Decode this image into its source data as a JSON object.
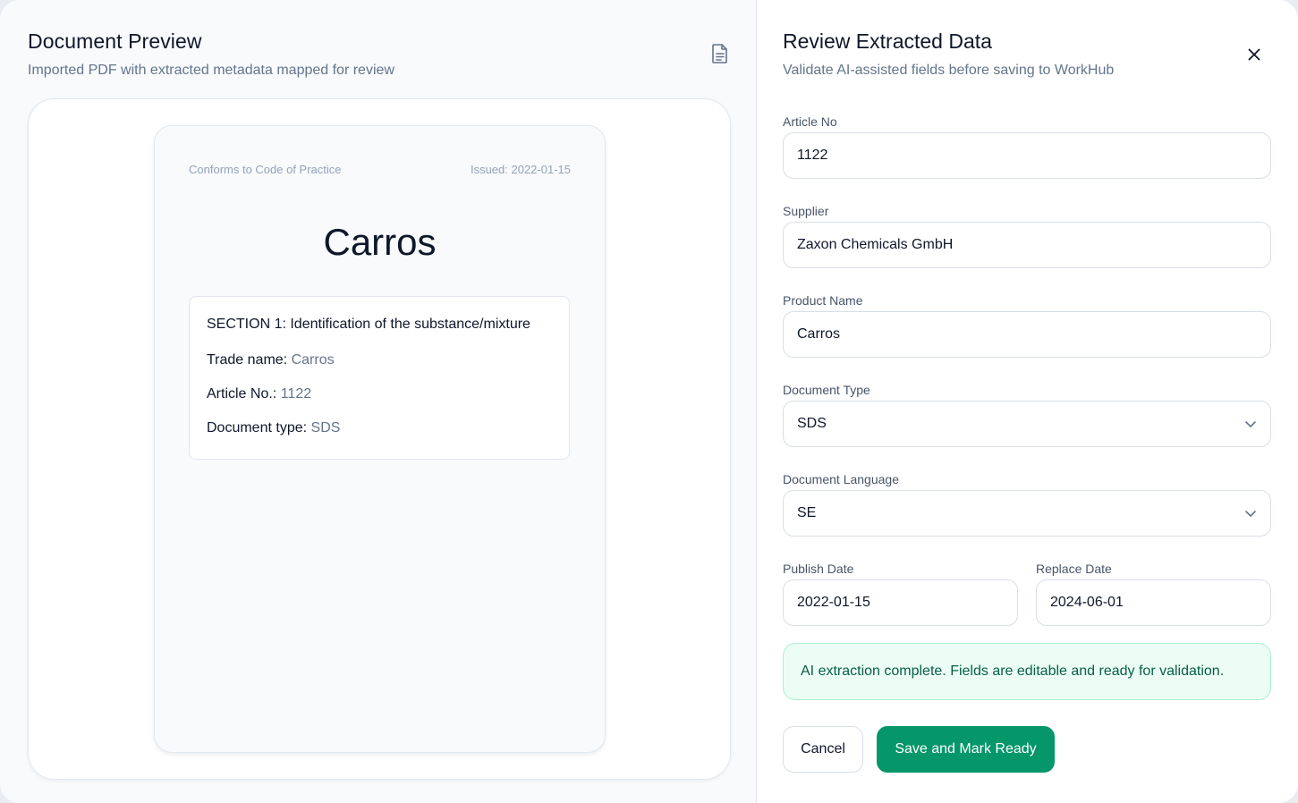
{
  "preview": {
    "title": "Document Preview",
    "subtitle": "Imported PDF with extracted metadata mapped for review",
    "icon": "document-icon",
    "page": {
      "conforms": "Conforms to Code of Practice",
      "issued": "Issued: 2022-01-15",
      "title": "Carros",
      "section_title": "SECTION 1: Identification of the substance/mixture",
      "rows": [
        {
          "key": "Trade name:",
          "value": "Carros"
        },
        {
          "key": "Article No.:",
          "value": "1122"
        },
        {
          "key": "Document type:",
          "value": "SDS"
        }
      ]
    }
  },
  "review": {
    "title": "Review Extracted Data",
    "subtitle": "Validate AI-assisted fields before saving to WorkHub",
    "close_icon": "close-icon",
    "fields": {
      "article_no": {
        "label": "Article No",
        "value": "1122"
      },
      "supplier": {
        "label": "Supplier",
        "value": "Zaxon Chemicals GmbH"
      },
      "product_name": {
        "label": "Product Name",
        "value": "Carros"
      },
      "document_type": {
        "label": "Document Type",
        "value": "SDS"
      },
      "document_language": {
        "label": "Document Language",
        "value": "SE"
      },
      "publish_date": {
        "label": "Publish Date",
        "value": "2022-01-15"
      },
      "replace_date": {
        "label": "Replace Date",
        "value": "2024-06-01"
      }
    },
    "notice": "AI extraction complete. Fields are editable and ready for validation.",
    "cancel_label": "Cancel",
    "save_label": "Save and Mark Ready"
  },
  "colors": {
    "accent": "#059669",
    "notice_bg": "#ecfdf5",
    "notice_border": "#a7f3d0",
    "text": "#0f172a",
    "muted": "#64748b"
  }
}
